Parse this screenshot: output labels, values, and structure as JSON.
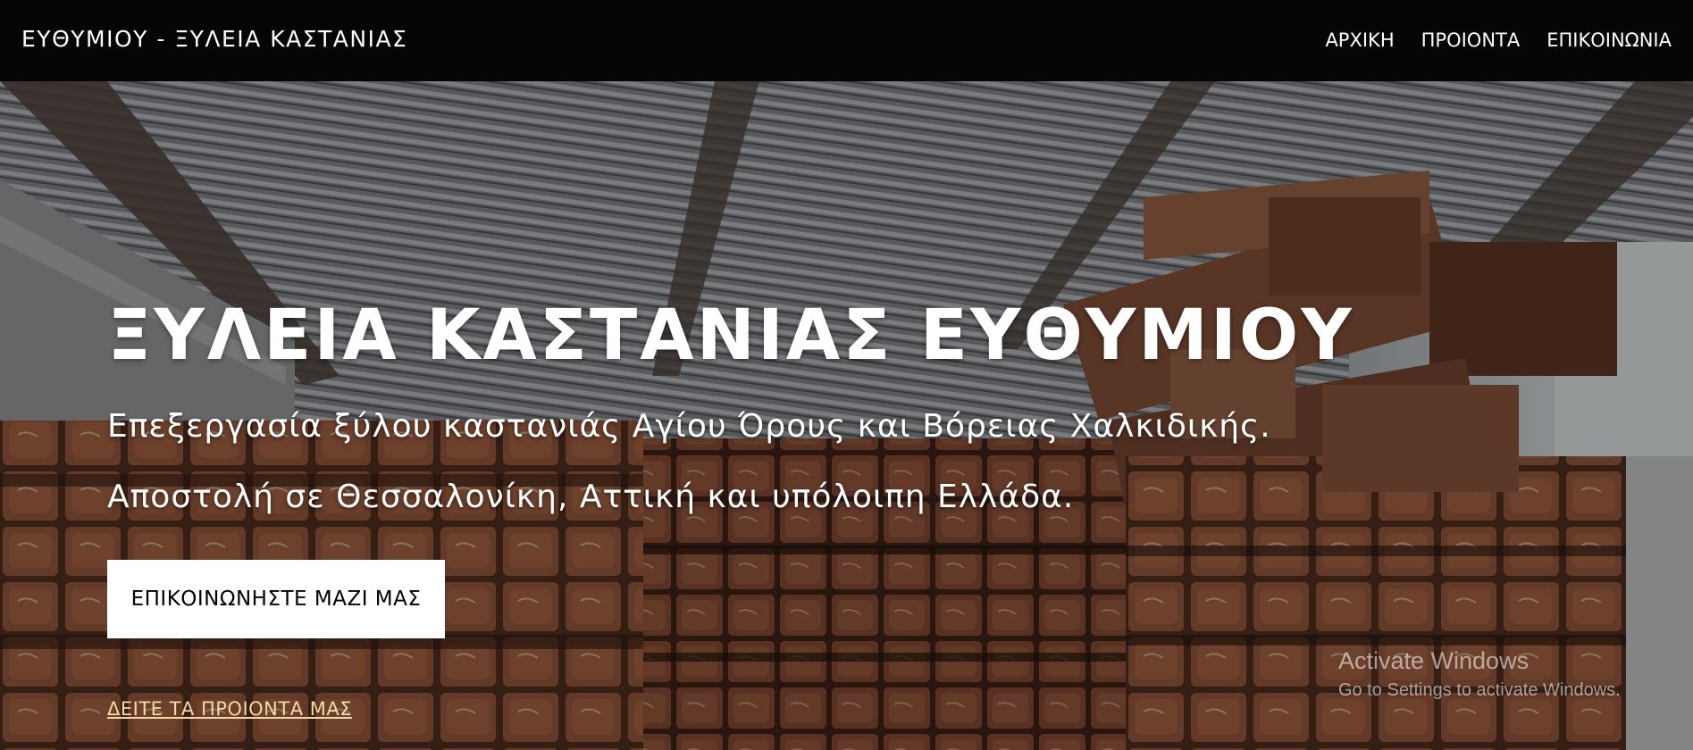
{
  "header": {
    "brand": "ΕΥΘΥΜΙΟΥ - ΞΥΛΕΙΑ ΚΑΣΤΑΝΙΑΣ",
    "nav": [
      {
        "label": "ΑΡΧΙΚΗ"
      },
      {
        "label": "ΠΡΟΙΟΝΤΑ"
      },
      {
        "label": "ΕΠΙΚΟΙΝΩΝΙΑ"
      }
    ]
  },
  "hero": {
    "title": "ΞΥΛΕΙΑ ΚΑΣΤΑΝΙΑΣ ΕΥΘΥΜΙΟΥ",
    "subtitle_line1": "Επεξεργασία ξύλου καστανιάς Αγίου Όρους και Βόρειας Χαλκιδικής.",
    "subtitle_line2": "Αποστολή σε Θεσσαλονίκη, Αττική και υπόλοιπη Ελλάδα.",
    "cta_label": "ΕΠΙΚΟΙΝΩΝΗΣΤΕ ΜΑΖΙ ΜΑΣ",
    "products_link": "ΔΕΙΤΕ ΤΑ ΠΡΟΙΟΝΤΑ ΜΑΣ"
  },
  "watermark": {
    "title": "Activate Windows",
    "subtitle": "Go to Settings to activate Windows."
  },
  "colors": {
    "navbar_bg": "#050505",
    "link_accent": "#f1dba4",
    "button_bg": "#ffffff"
  }
}
